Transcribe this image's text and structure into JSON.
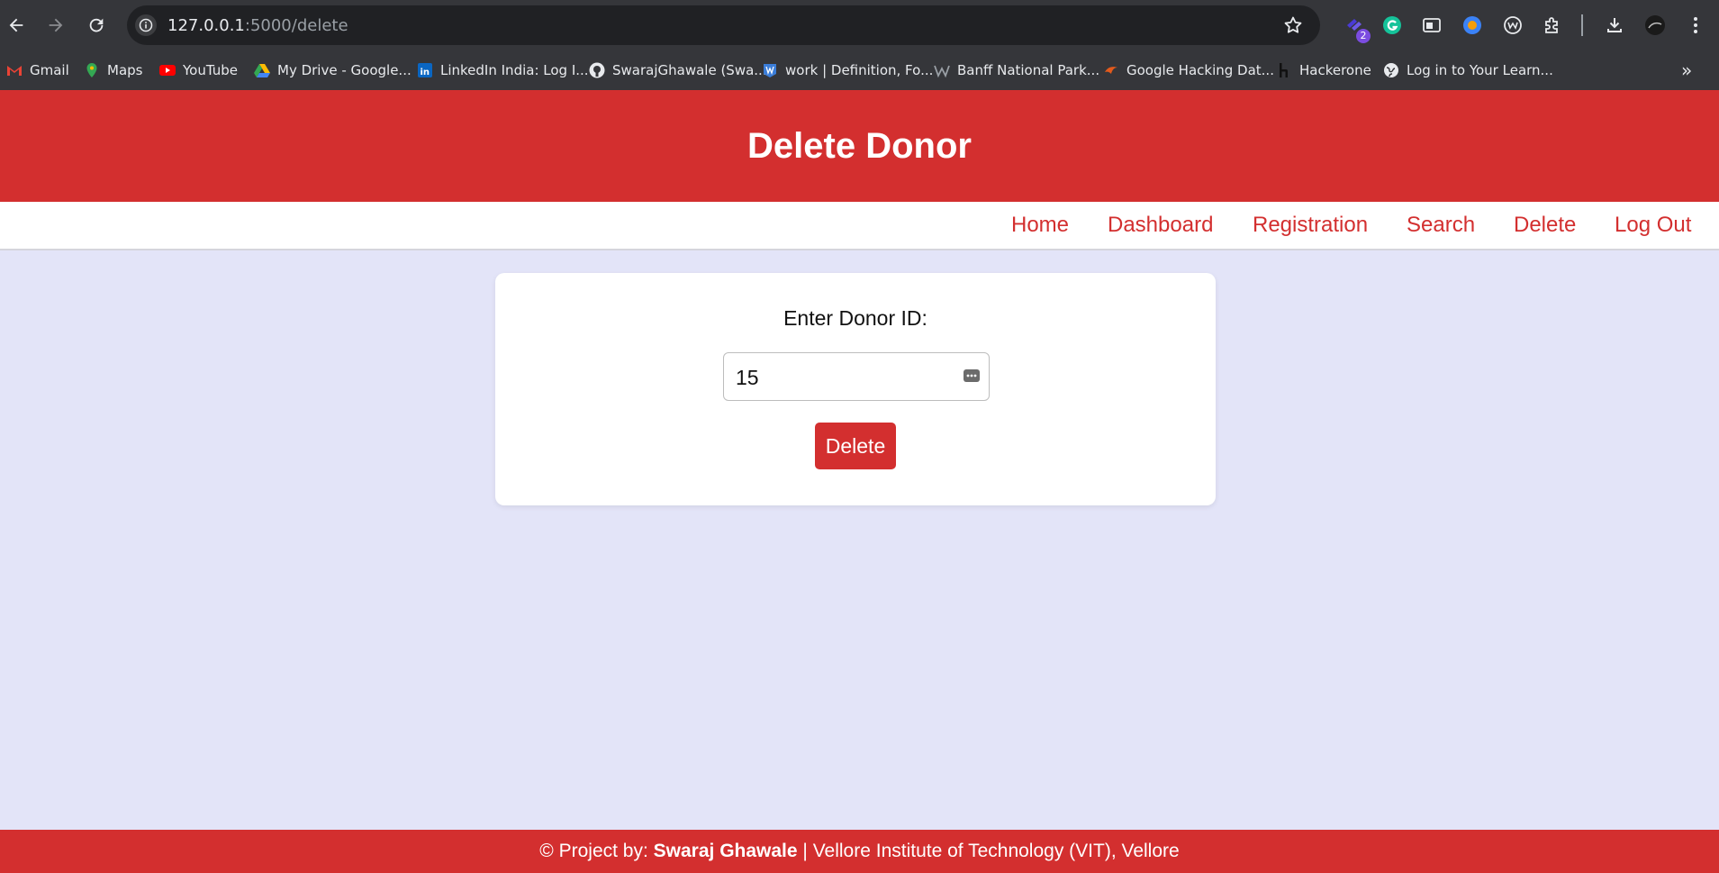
{
  "browser": {
    "url_host": "127.0.0.1",
    "url_path": ":5000/delete",
    "extension_badge": "2",
    "bookmarks": [
      {
        "label": "Gmail",
        "icon": "gmail-icon"
      },
      {
        "label": "Maps",
        "icon": "maps-icon"
      },
      {
        "label": "YouTube",
        "icon": "youtube-icon"
      },
      {
        "label": "My Drive - Google...",
        "icon": "drive-icon"
      },
      {
        "label": "LinkedIn India: Log I...",
        "icon": "linkedin-icon"
      },
      {
        "label": "SwarajGhawale (Swa...",
        "icon": "github-icon"
      },
      {
        "label": "work | Definition, Fo...",
        "icon": "dictionary-icon"
      },
      {
        "label": "Banff National Park...",
        "icon": "wikipedia-icon"
      },
      {
        "label": "Google Hacking Dat...",
        "icon": "exploit-db-icon"
      },
      {
        "label": "Hackerone",
        "icon": "hackerone-icon"
      },
      {
        "label": "Log in to Your Learn...",
        "icon": "globe-icon"
      }
    ]
  },
  "header": {
    "title": "Delete Donor"
  },
  "nav": {
    "items": [
      "Home",
      "Dashboard",
      "Registration",
      "Search",
      "Delete",
      "Log Out"
    ]
  },
  "form": {
    "label": "Enter Donor ID:",
    "donor_id_value": "15",
    "submit_label": "Delete"
  },
  "footer": {
    "prefix": "© Project by: ",
    "author": "Swaraj Ghawale",
    "suffix": " | Vellore Institute of Technology (VIT), Vellore"
  },
  "colors": {
    "brand_red": "#d32f2f",
    "page_background": "#e3e4f8"
  }
}
